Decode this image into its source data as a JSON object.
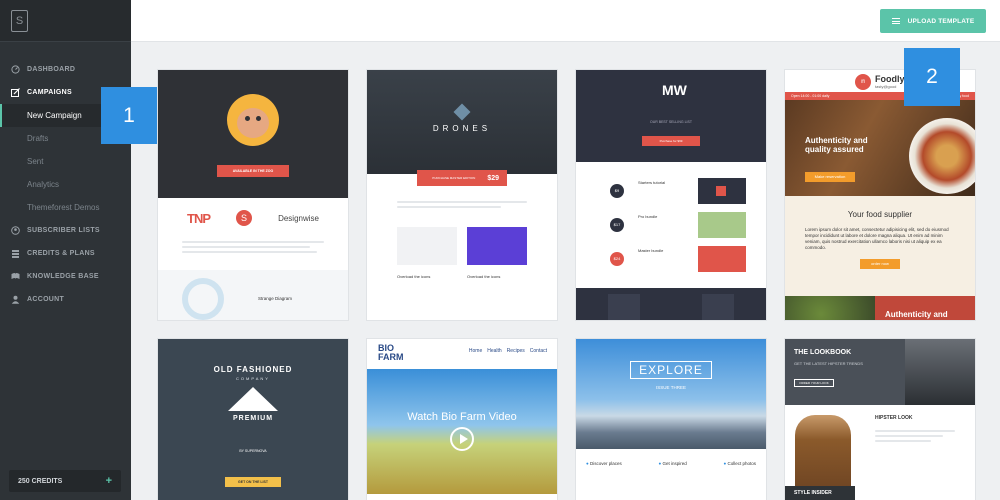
{
  "app": {
    "logo_letter": "S",
    "accent": "#5bc4a9"
  },
  "sidebar": {
    "items": [
      {
        "label": "DASHBOARD",
        "icon": "gauge-icon"
      },
      {
        "label": "CAMPAIGNS",
        "icon": "edit-icon"
      },
      {
        "label": "New Campaign"
      },
      {
        "label": "Drafts"
      },
      {
        "label": "Sent"
      },
      {
        "label": "Analytics"
      },
      {
        "label": "Themeforest Demos"
      },
      {
        "label": "SUBSCRIBER LISTS",
        "icon": "users-icon"
      },
      {
        "label": "CREDITS & PLANS",
        "icon": "coins-icon"
      },
      {
        "label": "KNOWLEDGE BASE",
        "icon": "book-icon"
      },
      {
        "label": "ACCOUNT",
        "icon": "user-icon"
      }
    ],
    "credits_label": "250 CREDITS",
    "credits_plus": "+"
  },
  "topbar": {
    "upload_label": "UPLOAD TEMPLATE"
  },
  "callouts": [
    "1",
    "2"
  ],
  "templates": {
    "t1": {
      "hero_btn": "AVAILABLE IN THE ZOO",
      "logo1": "TNP",
      "logo2": "S",
      "logo3": "Designwise",
      "section": "Strange Diagram"
    },
    "t2": {
      "title": "DRONES",
      "price": "$29",
      "price_note": "PURCHASE MASTER EDITION",
      "col1": "Overload the icons",
      "col2": "Overload the icons"
    },
    "t3": {
      "logo": "MW",
      "btn": "Purchase for $99",
      "tagline": "OUR BEST SELLING LIST",
      "prices": [
        "$9",
        "$17",
        "$24"
      ],
      "items": [
        "Starters tutorial",
        "Pro bundle",
        "Master bundle"
      ]
    },
    "t4": {
      "brand": "Foodly",
      "tag": "tasty@good",
      "hours": "Open 14:00 - 01:00 daily",
      "phone": "1-888-happy food",
      "headline": "Authenticity and quality assured",
      "reserve": "Make reservation",
      "supplier": "Your food supplier",
      "lorem": "Lorem ipsum dolor sit amet, consectetur adipisicing elit, sed do eiusmod tempor incididunt ut labore et dolore magna aliqua. Ut enim ad minim veniam, quis nostrud exercitation ullamco laboris nisi ut aliquip ex ea commodo.",
      "order": "order now",
      "footer": "Authenticity and"
    },
    "t5": {
      "title": "OLD FASHIONED",
      "company": "COMPANY",
      "premium": "PREMIUM",
      "by": "BY SUPERNOVA",
      "btn": "GET ON THE LIST"
    },
    "t6": {
      "logo_line1": "BIO",
      "logo_line2": "FARM",
      "menu": [
        "Home",
        "Health",
        "Recipes",
        "Contact"
      ],
      "video_title": "Watch Bio Farm Video"
    },
    "t7": {
      "title": "EXPLORE",
      "sub": "ISSUE THREE",
      "features": [
        "Discover places",
        "Get inspired",
        "Collect photos"
      ]
    },
    "t8": {
      "title": "THE LOOKBOOK",
      "sub": "GET THE LATEST HIPSTER TRENDS",
      "btn": "ORDER YOUR LOOK",
      "hipster": "HIPSTER LOOK",
      "style": "STYLE INSIDER"
    }
  }
}
